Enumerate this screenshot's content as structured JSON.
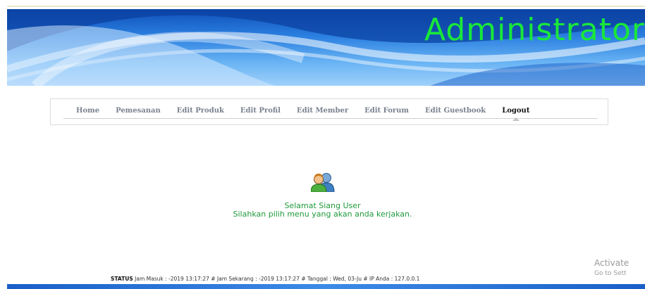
{
  "header": {
    "title": "Administrator",
    "title_color": "#19e83a"
  },
  "menu": {
    "items": [
      {
        "label": "Home"
      },
      {
        "label": "Pemesanan"
      },
      {
        "label": "Edit Produk"
      },
      {
        "label": "Edit Profil"
      },
      {
        "label": "Edit Member"
      },
      {
        "label": "Edit Forum"
      },
      {
        "label": "Edit Guestbook"
      },
      {
        "label": "Logout"
      }
    ],
    "active": "Logout"
  },
  "main": {
    "icon": "users-icon",
    "greeting": "Selamat Siang User",
    "instruction": "Silahkan pilih menu yang akan anda kerjakan.",
    "text_color": "#1f9a3b"
  },
  "status": {
    "label": "STATUS",
    "text": "Jam Masuk : -2019 13:17:27 # Jam Sekarang : -2019 13:17:27 # Tanggal : Wed, 03-Ju # IP Anda : 127.0.0.1"
  },
  "watermark": {
    "line1": "Activate",
    "line2": "Go to Sett"
  }
}
